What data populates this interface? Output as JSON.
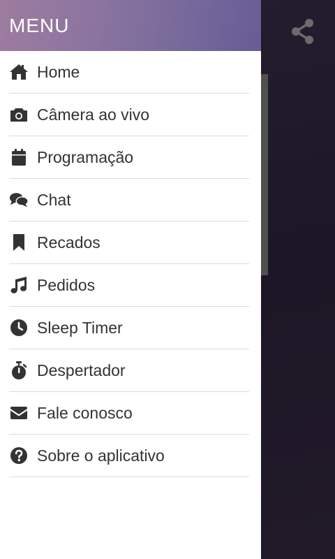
{
  "drawer": {
    "title": "MENU",
    "items": [
      {
        "label": "Home",
        "icon": "home-icon"
      },
      {
        "label": "Câmera ao vivo",
        "icon": "camera-icon"
      },
      {
        "label": "Programação",
        "icon": "calendar-icon"
      },
      {
        "label": "Chat",
        "icon": "chat-icon"
      },
      {
        "label": "Recados",
        "icon": "bookmark-icon"
      },
      {
        "label": "Pedidos",
        "icon": "music-icon"
      },
      {
        "label": "Sleep Timer",
        "icon": "clock-icon"
      },
      {
        "label": "Despertador",
        "icon": "stopwatch-icon"
      },
      {
        "label": "Fale conosco",
        "icon": "envelope-icon"
      },
      {
        "label": "Sobre o aplicativo",
        "icon": "question-circle-icon"
      }
    ]
  },
  "header": {
    "share_icon": "share-icon"
  },
  "colors": {
    "header_gradient_start": "#9d7c9f",
    "header_gradient_end": "#675c95",
    "text": "#333333",
    "divider": "#dcdcdc",
    "background": "#1c1626"
  }
}
